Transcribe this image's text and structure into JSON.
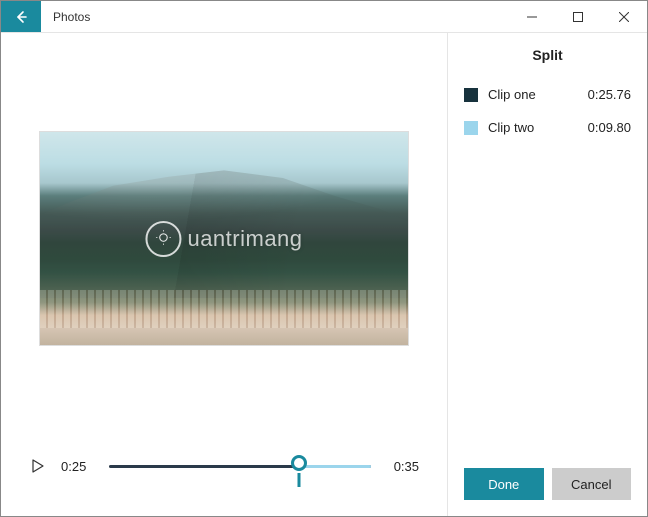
{
  "titlebar": {
    "app_name": "Photos"
  },
  "panel": {
    "title": "Split",
    "clips": [
      {
        "label": "Clip one",
        "duration": "0:25.76",
        "color": "#17323d"
      },
      {
        "label": "Clip two",
        "duration": "0:09.80",
        "color": "#9bd5ec"
      }
    ],
    "done_label": "Done",
    "cancel_label": "Cancel"
  },
  "transport": {
    "current_time": "0:25",
    "total_time": "0:35",
    "split_fraction": 0.725
  },
  "watermark": {
    "text": "uantrimang"
  }
}
